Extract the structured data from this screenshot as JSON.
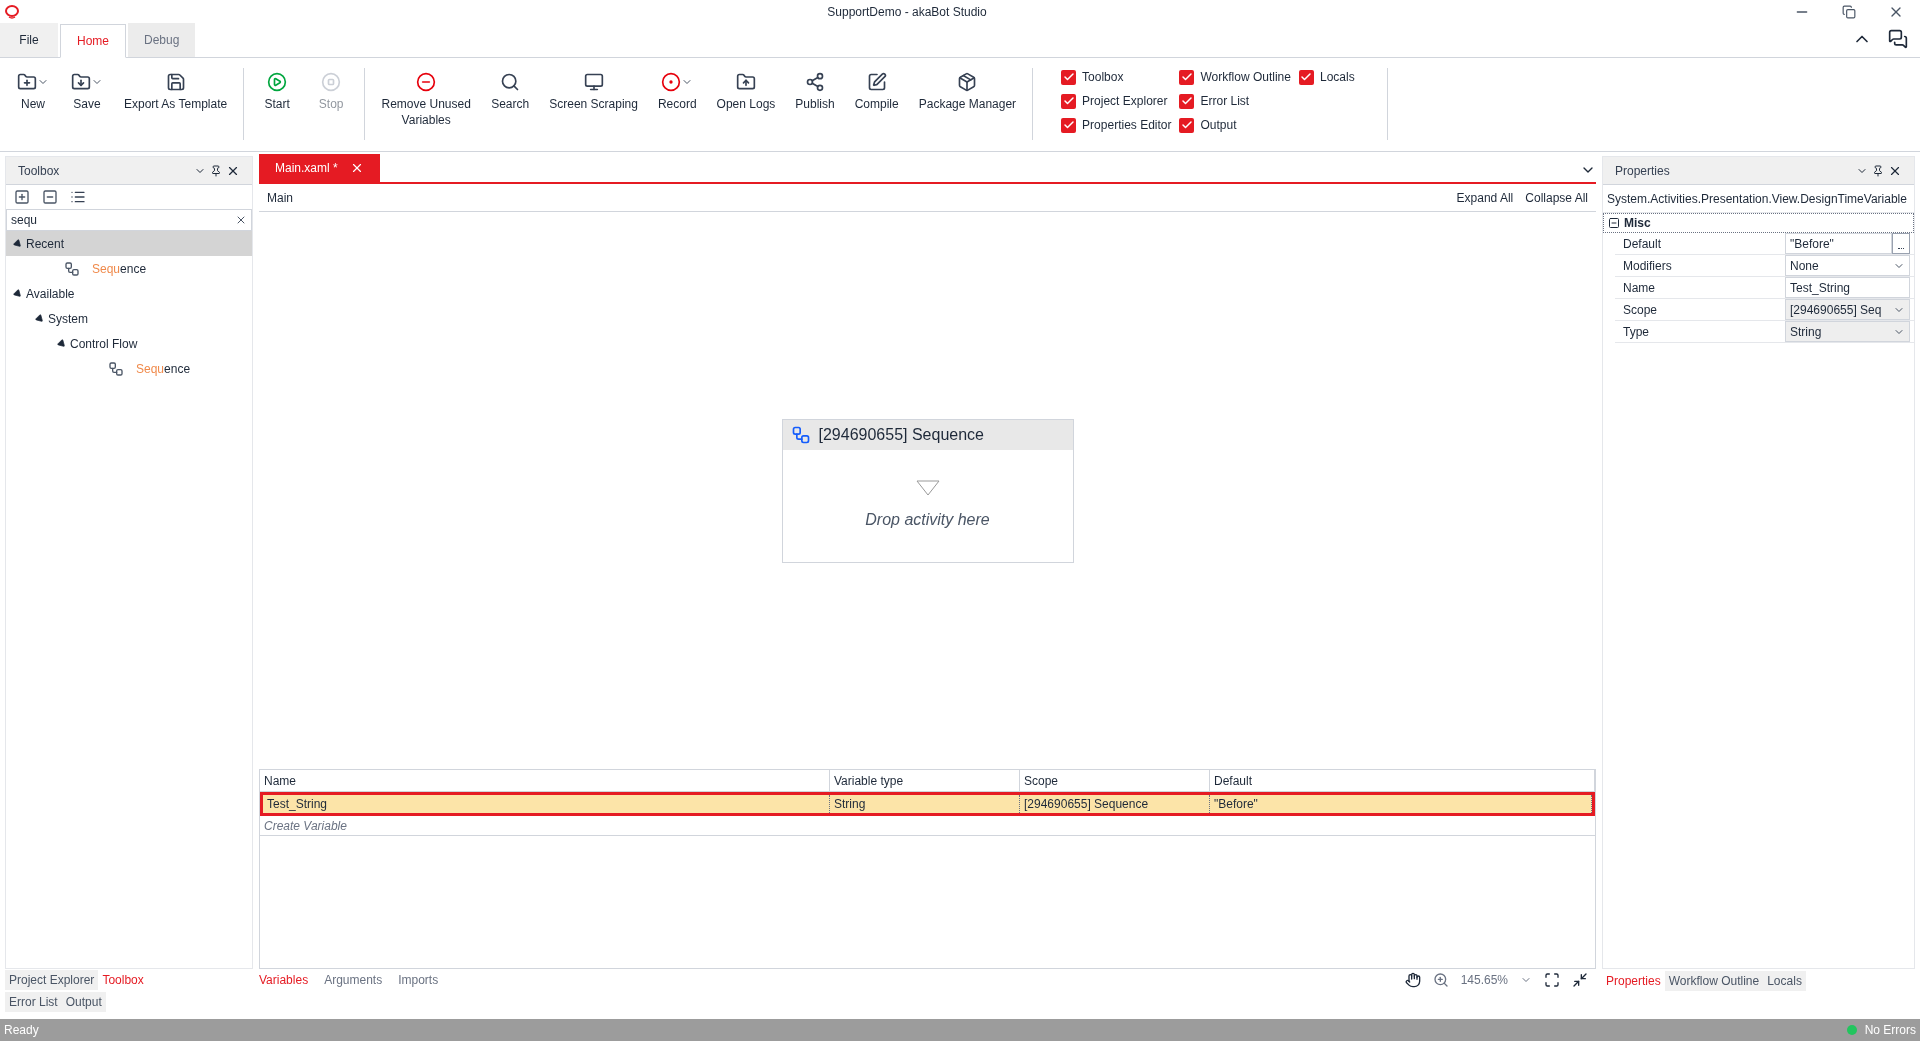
{
  "window": {
    "title": "SupportDemo - akaBot Studio"
  },
  "menu_tabs": [
    {
      "label": "File",
      "selected": false,
      "kind": "file"
    },
    {
      "label": "Home",
      "selected": true,
      "kind": "tab"
    },
    {
      "label": "Debug",
      "selected": false,
      "kind": "tab"
    }
  ],
  "ribbon_groups": [
    [
      {
        "label": "New",
        "dropdown": true,
        "disabled": false
      },
      {
        "label": "Save",
        "dropdown": true,
        "disabled": false
      },
      {
        "label": "Export As Template",
        "dropdown": false,
        "disabled": false
      }
    ],
    [
      {
        "label": "Start",
        "dropdown": false,
        "disabled": false
      },
      {
        "label": "Stop",
        "dropdown": false,
        "disabled": true
      }
    ],
    [
      {
        "label": "Remove Unused Variables",
        "dropdown": false,
        "disabled": false
      },
      {
        "label": "Search",
        "dropdown": false,
        "disabled": false
      },
      {
        "label": "Screen Scraping",
        "dropdown": false,
        "disabled": false
      },
      {
        "label": "Record",
        "dropdown": true,
        "disabled": false
      },
      {
        "label": "Open Logs",
        "dropdown": false,
        "disabled": false
      },
      {
        "label": "Publish",
        "dropdown": false,
        "disabled": false
      },
      {
        "label": "Compile",
        "dropdown": false,
        "disabled": false
      },
      {
        "label": "Package Manager",
        "dropdown": false,
        "disabled": false
      }
    ]
  ],
  "panel_toggles": [
    [
      {
        "label": "Toolbox",
        "checked": true
      },
      {
        "label": "Project Explorer",
        "checked": true
      },
      {
        "label": "Properties Editor",
        "checked": true
      }
    ],
    [
      {
        "label": "Workflow Outline",
        "checked": true
      },
      {
        "label": "Error List",
        "checked": true
      },
      {
        "label": "Output",
        "checked": true
      }
    ],
    [
      {
        "label": "Locals",
        "checked": true
      }
    ]
  ],
  "toolbox": {
    "title": "Toolbox",
    "search": "sequ",
    "tree": [
      {
        "label": "Recent",
        "expanded": true,
        "selected": true,
        "children": [
          {
            "kind": "activity",
            "match": "Sequ",
            "rest": "ence",
            "selected": false
          }
        ]
      },
      {
        "label": "Available",
        "expanded": true,
        "selected": false,
        "children": [
          {
            "label": "System",
            "expanded": true,
            "selected": false,
            "children": [
              {
                "label": "Control Flow",
                "expanded": true,
                "selected": false,
                "children": [
                  {
                    "kind": "activity",
                    "match": "Sequ",
                    "rest": "ence",
                    "selected": false
                  }
                ]
              }
            ]
          }
        ]
      }
    ],
    "bottom_tabs": [
      [
        {
          "label": "Project Explorer",
          "selected": false
        },
        {
          "label": "Toolbox",
          "selected": true
        }
      ],
      [
        {
          "label": "Error List",
          "selected": false
        },
        {
          "label": "Output",
          "selected": false
        }
      ]
    ]
  },
  "document_tab": {
    "label": "Main.xaml *"
  },
  "designer": {
    "breadcrumb": "Main",
    "expand_all": "Expand All",
    "collapse_all": "Collapse All",
    "activity": {
      "title": "[294690655] Sequence",
      "hint": "Drop activity here"
    }
  },
  "variables": {
    "columns": [
      "Name",
      "Variable type",
      "Scope",
      "Default"
    ],
    "rows": [
      {
        "cells": [
          "Test_String",
          "String",
          "[294690655] Sequence",
          "\"Before\""
        ],
        "selected": true
      }
    ],
    "create": "Create Variable"
  },
  "designer_tabs": [
    {
      "label": "Variables",
      "selected": true
    },
    {
      "label": "Arguments",
      "selected": false
    },
    {
      "label": "Imports",
      "selected": false
    }
  ],
  "zoom": "145.65%",
  "properties": {
    "title": "Properties",
    "type_name": "System.Activities.Presentation.View.DesignTimeVariable",
    "category": "Misc",
    "rows": [
      {
        "label": "Default",
        "value": "\"Before\"",
        "kind": "ellipsis"
      },
      {
        "label": "Modifiers",
        "value": "None",
        "kind": "dropdown"
      },
      {
        "label": "Name",
        "value": "Test_String",
        "kind": "text"
      },
      {
        "label": "Scope",
        "value": "[294690655] Seq",
        "kind": "dropdown"
      },
      {
        "label": "Type",
        "value": "String",
        "kind": "dropdown"
      }
    ],
    "bottom_tabs": [
      {
        "label": "Properties",
        "selected": true
      },
      {
        "label": "Workflow Outline",
        "selected": false
      },
      {
        "label": "Locals",
        "selected": false
      }
    ]
  },
  "status_bar": {
    "left": "Ready",
    "right": "No Errors"
  }
}
